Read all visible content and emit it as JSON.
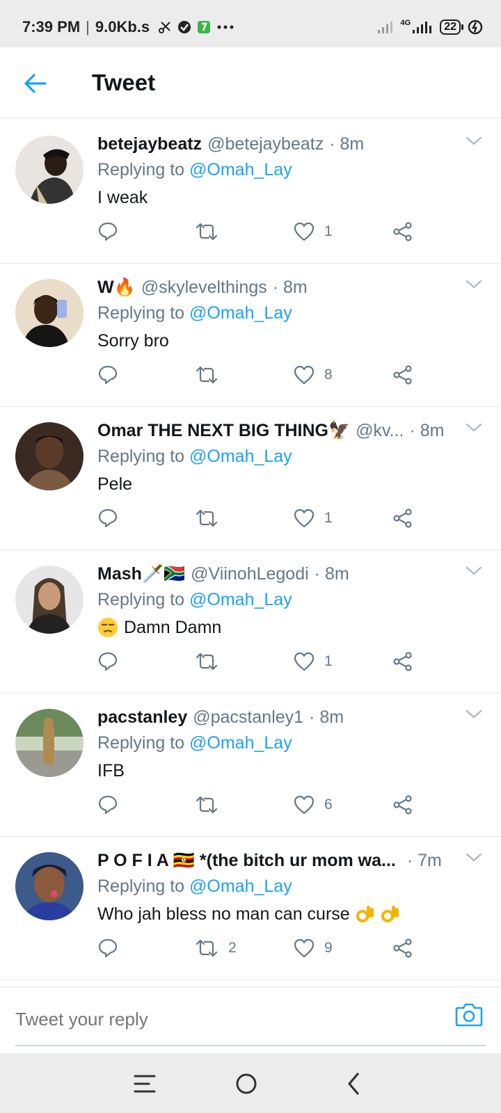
{
  "status_bar": {
    "time": "7:39 PM",
    "speed": "9.0Kb.s",
    "network": "4G",
    "battery": "22"
  },
  "header": {
    "title": "Tweet"
  },
  "replying_label": "Replying to",
  "mention": "@Omah_Lay",
  "tweets": [
    {
      "name": "betejaybeatz",
      "handle": "@betejaybeatz",
      "time": "· 8m",
      "text": "I weak",
      "retweets": "",
      "likes": "1"
    },
    {
      "name": "W🔥",
      "handle": "@skylevelthings",
      "time": "· 8m",
      "text": "Sorry bro",
      "retweets": "",
      "likes": "8"
    },
    {
      "name": "Omar THE NEXT BIG THING🦅",
      "handle": "@kv...",
      "time": "· 8m",
      "text": "Pele",
      "retweets": "",
      "likes": "1"
    },
    {
      "name": "Mash🗡️🇿🇦",
      "handle": "@ViinohLegodi",
      "time": "· 8m",
      "text": "Damn Damn",
      "retweets": "",
      "likes": "1"
    },
    {
      "name": "pacstanley",
      "handle": "@pacstanley1",
      "time": "· 8m",
      "text": "IFB",
      "retweets": "",
      "likes": "6"
    },
    {
      "name": "P O F I A 🇺🇬 *(the bitch ur mom wa...",
      "handle": "",
      "time": "· 7m",
      "text": "Who jah bless no man can curse",
      "retweets": "2",
      "likes": "9"
    }
  ],
  "reply_bar": {
    "placeholder": "Tweet your reply"
  },
  "colors": {
    "accent": "#1da1f2",
    "secondary_text": "#657786",
    "divider": "#e1e8ed"
  }
}
